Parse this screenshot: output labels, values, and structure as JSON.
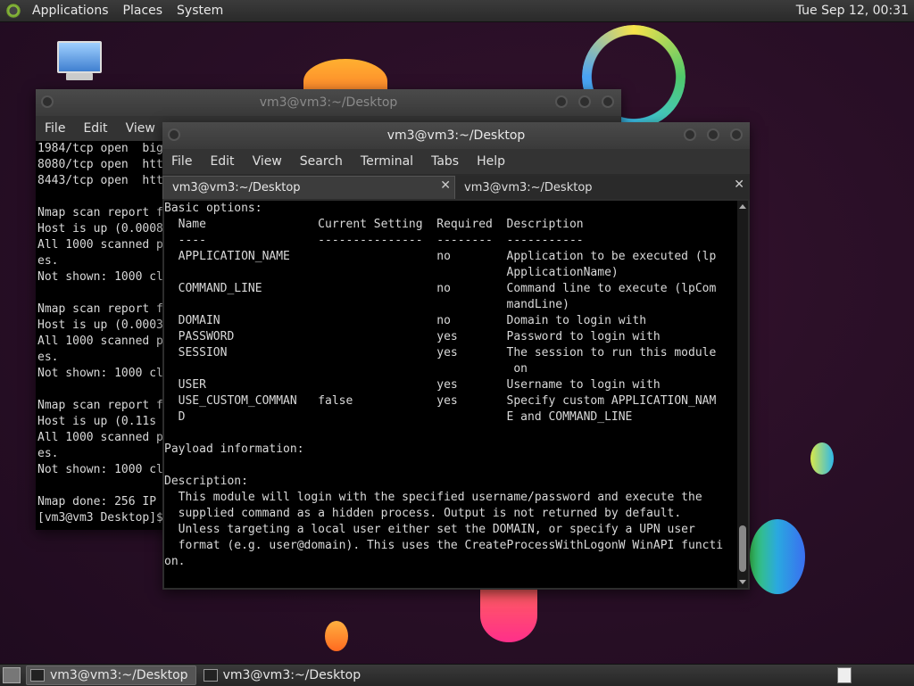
{
  "top_panel": {
    "menus": [
      "Applications",
      "Places",
      "System"
    ],
    "clock": "Tue Sep 12, 00:31"
  },
  "back_window": {
    "title": "vm3@vm3:~/Desktop",
    "menus": [
      "File",
      "Edit",
      "View"
    ],
    "lines": [
      "1984/tcp open  big",
      "8080/tcp open  htt",
      "8443/tcp open  htt",
      "",
      "Nmap scan report f",
      "Host is up (0.0008",
      "All 1000 scanned p",
      "es.",
      "Not shown: 1000 cl",
      "",
      "Nmap scan report f",
      "Host is up (0.0003",
      "All 1000 scanned p",
      "es.",
      "Not shown: 1000 cl",
      "",
      "Nmap scan report f",
      "Host is up (0.11s ",
      "All 1000 scanned p",
      "es.",
      "Not shown: 1000 cl",
      "",
      "Nmap done: 256 IP ",
      "[vm3@vm3 Desktop]$"
    ]
  },
  "front_window": {
    "title": "vm3@vm3:~/Desktop",
    "menus": [
      "File",
      "Edit",
      "View",
      "Search",
      "Terminal",
      "Tabs",
      "Help"
    ],
    "tabs": [
      {
        "label": "vm3@vm3:~/Desktop",
        "close": "✕"
      },
      {
        "label": "vm3@vm3:~/Desktop",
        "close": "✕"
      }
    ],
    "lines": [
      "Basic options:",
      "  Name                Current Setting  Required  Description",
      "  ----                ---------------  --------  -----------",
      "  APPLICATION_NAME                     no        Application to be executed (lp",
      "                                                 ApplicationName)",
      "  COMMAND_LINE                         no        Command line to execute (lpCom",
      "                                                 mandLine)",
      "  DOMAIN                               no        Domain to login with",
      "  PASSWORD                             yes       Password to login with",
      "  SESSION                              yes       The session to run this module",
      "                                                  on",
      "  USER                                 yes       Username to login with",
      "  USE_CUSTOM_COMMAN   false            yes       Specify custom APPLICATION_NAM",
      "  D                                              E and COMMAND_LINE",
      "",
      "Payload information:",
      "",
      "Description:",
      "  This module will login with the specified username/password and execute the",
      "  supplied command as a hidden process. Output is not returned by default.",
      "  Unless targeting a local user either set the DOMAIN, or specify a UPN user",
      "  format (e.g. user@domain). This uses the CreateProcessWithLogonW WinAPI functi",
      "on."
    ]
  },
  "taskbar": {
    "tasks": [
      "vm3@vm3:~/Desktop",
      "vm3@vm3:~/Desktop"
    ]
  }
}
